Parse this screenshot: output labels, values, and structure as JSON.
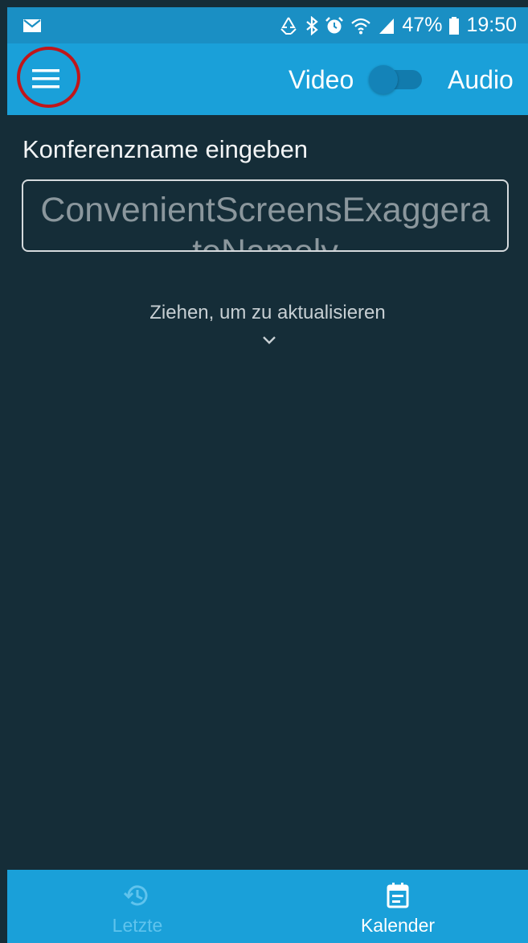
{
  "status_bar": {
    "battery_percent": "47%",
    "time": "19:50",
    "icons": [
      "mail-icon",
      "recycle-icon",
      "bluetooth-icon",
      "alarm-icon",
      "wifi-icon",
      "signal-icon",
      "battery-icon"
    ]
  },
  "app_bar": {
    "menu_icon": "hamburger-icon",
    "mode_video_label": "Video",
    "mode_audio_label": "Audio",
    "toggle_selected": "Video"
  },
  "conference": {
    "label": "Konferenzname eingeben",
    "input_value": "ConvenientScreensExaggerateNamely"
  },
  "pull_to_refresh": {
    "text": "Ziehen, um zu aktualisieren",
    "icon": "chevron-down-icon"
  },
  "bottom_nav": {
    "items": [
      {
        "label": "Letzte",
        "icon": "history-icon",
        "active": false
      },
      {
        "label": "Kalender",
        "icon": "calendar-icon",
        "active": true
      }
    ]
  },
  "colors": {
    "primary": "#1aa0d9",
    "status_bar": "#1a8fc4",
    "background": "#152d38",
    "annotation_circle": "#c0161a"
  }
}
